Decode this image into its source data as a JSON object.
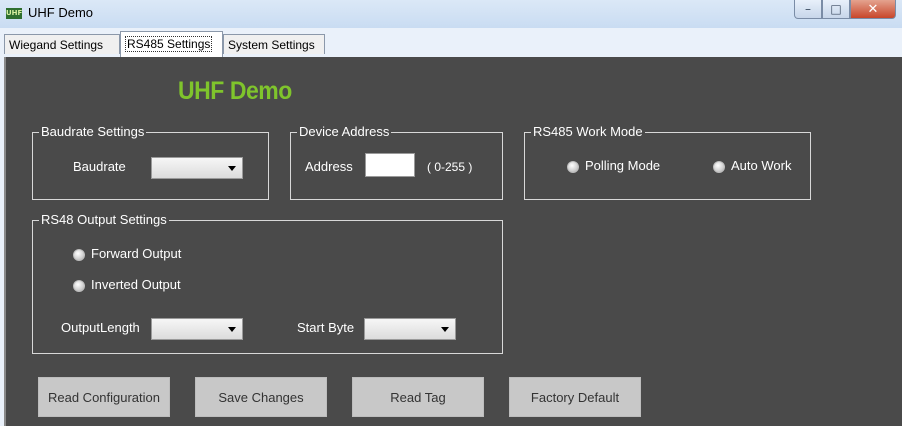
{
  "window": {
    "title": "UHF Demo",
    "app_icon_text": "UHF",
    "icons": {
      "minimize": "minimize-icon",
      "maximize": "maximize-icon",
      "close": "close-icon"
    }
  },
  "tabs": [
    {
      "label": "Wiegand Settings",
      "active": false
    },
    {
      "label": "RS485 Settings",
      "active": true
    },
    {
      "label": "System Settings",
      "active": false
    }
  ],
  "heading": "UHF Demo",
  "baudrate_group": {
    "title": "Baudrate Settings",
    "label": "Baudrate",
    "value": ""
  },
  "address_group": {
    "title": "Device Address",
    "label": "Address",
    "value": "",
    "range": "( 0-255 )"
  },
  "workmode_group": {
    "title": "RS485 Work Mode",
    "options": [
      "Polling Mode",
      "Auto Work"
    ]
  },
  "output_group": {
    "title": "RS48 Output Settings",
    "options": [
      "Forward Output",
      "Inverted Output"
    ],
    "output_length_label": "OutputLength",
    "output_length_value": "",
    "start_byte_label": "Start Byte",
    "start_byte_value": ""
  },
  "buttons": {
    "read_config": "Read Configuration",
    "save_changes": "Save Changes",
    "read_tag": "Read Tag",
    "factory_default": "Factory Default"
  },
  "colors": {
    "heading": "#7fc42c",
    "panel_bg": "#4a4a4a",
    "button_bg": "#c8c8c8"
  }
}
